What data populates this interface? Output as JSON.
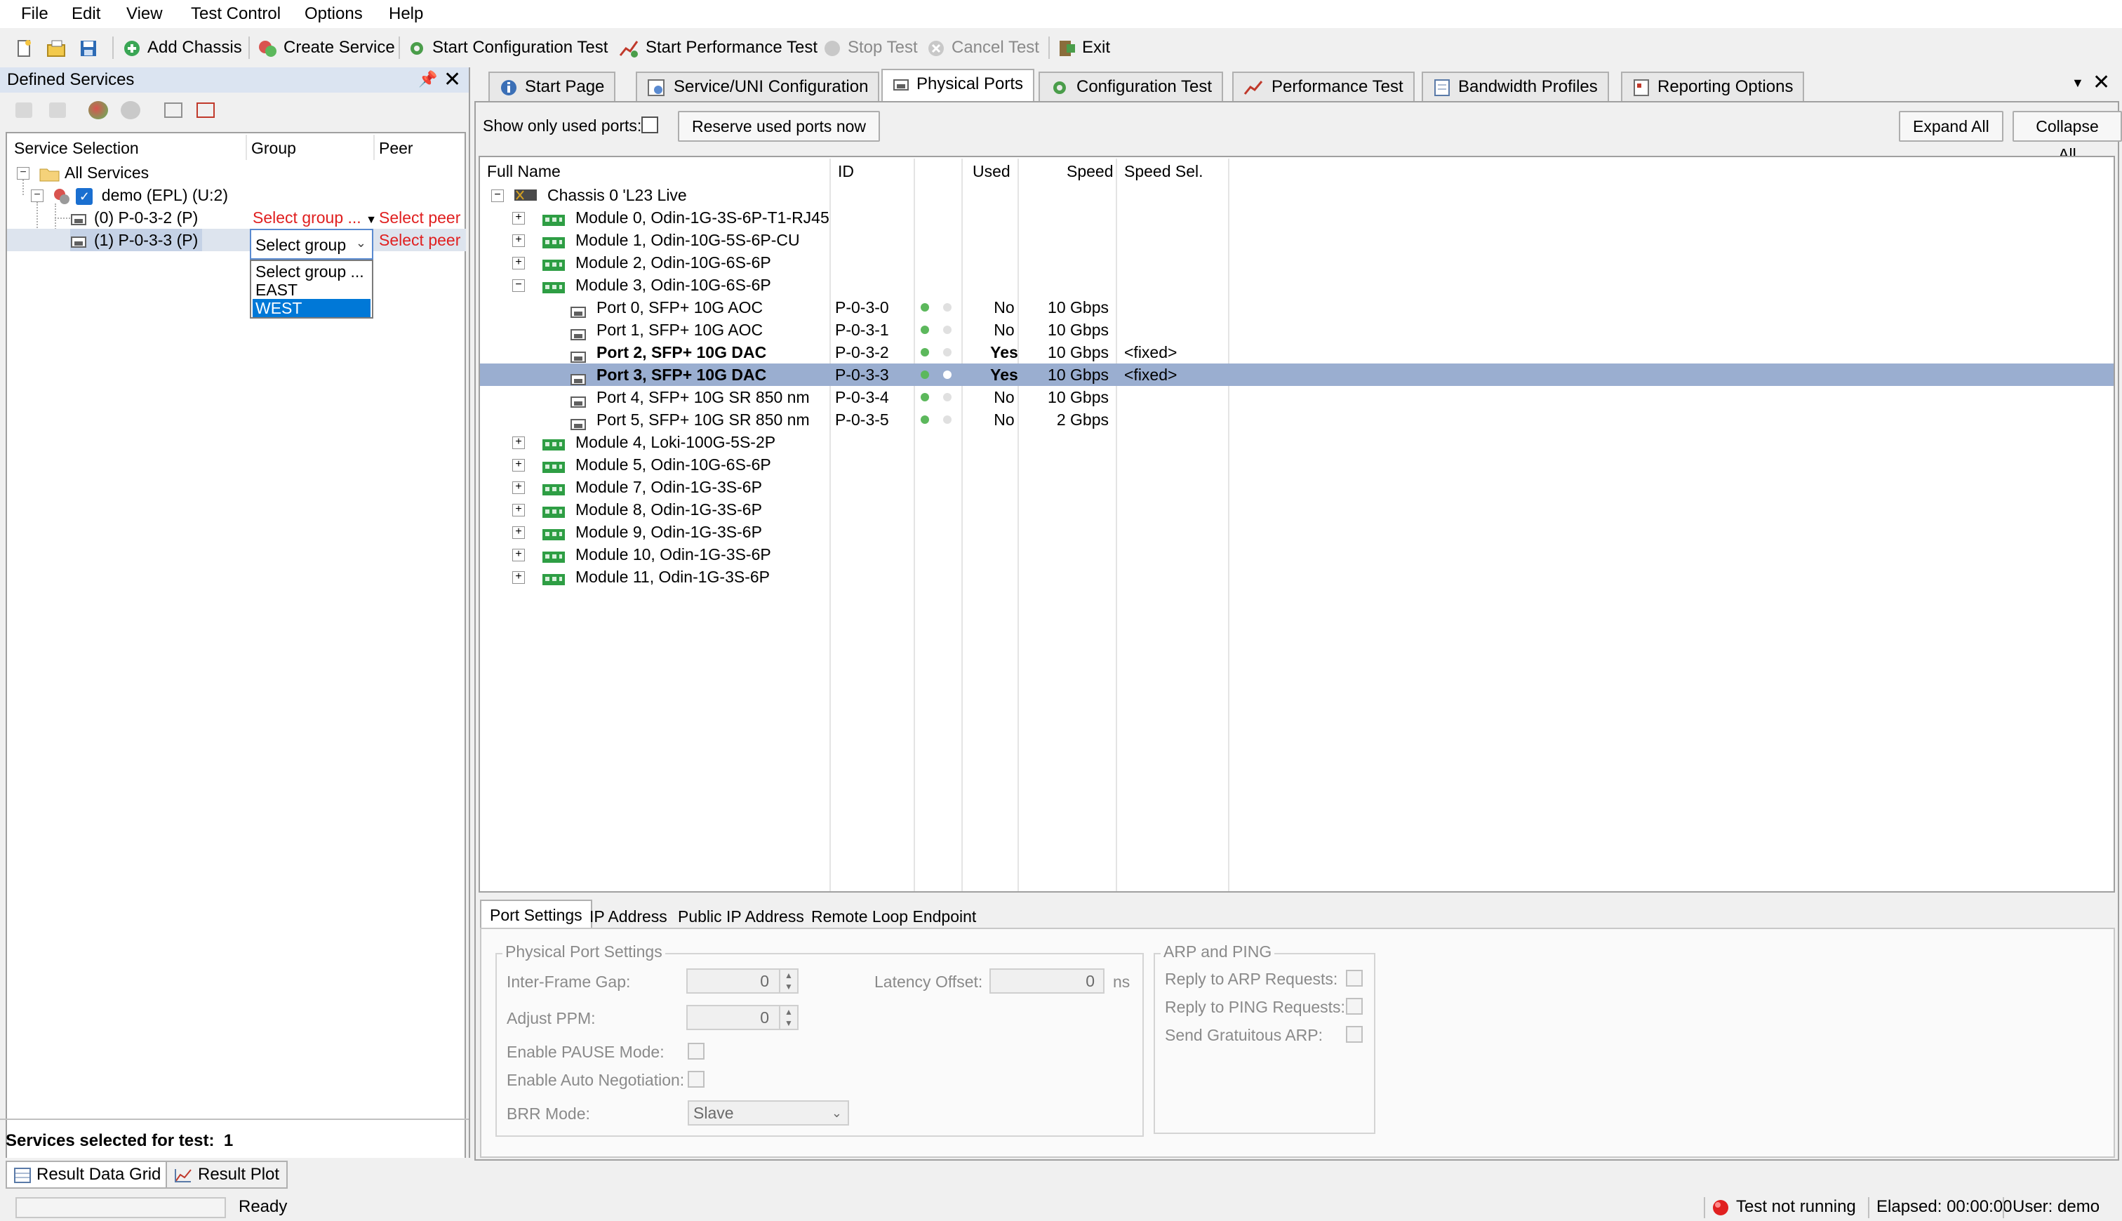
{
  "menu": [
    "File",
    "Edit",
    "View",
    "Test Control",
    "Options",
    "Help"
  ],
  "toolbar": {
    "add_chassis": "Add Chassis",
    "create_service": "Create Service",
    "start_config_test": "Start Configuration Test",
    "start_perf_test": "Start Performance Test",
    "stop_test": "Stop Test",
    "cancel_test": "Cancel Test",
    "exit": "Exit"
  },
  "left_panel": {
    "title": "Defined Services",
    "columns": {
      "selection": "Service Selection",
      "group": "Group",
      "peer": "Peer"
    },
    "tree": {
      "root": "All Services",
      "service": "demo (EPL) (U:2)",
      "ports": [
        {
          "label": "(0) P-0-3-2 (P)",
          "group": "Select group ...",
          "peer": "Select peer ..."
        },
        {
          "label": "(1) P-0-3-3 (P)",
          "group": "Select group",
          "peer": "Select peer ..."
        }
      ]
    },
    "dropdown_options": [
      "Select group ...",
      "EAST",
      "WEST"
    ],
    "services_selected_label": "Services selected for test:",
    "services_selected_count": "1",
    "bottom_tabs": [
      "Result Data Grid",
      "Result Plot"
    ]
  },
  "tabs": [
    "Start Page",
    "Service/UNI Configuration",
    "Physical Ports",
    "Configuration Test",
    "Performance Test",
    "Bandwidth Profiles",
    "Reporting Options"
  ],
  "ports_view": {
    "show_used_label": "Show only used ports:",
    "reserve_button": "Reserve used ports now",
    "expand_all": "Expand All",
    "collapse_all": "Collapse All",
    "columns": {
      "full_name": "Full Name",
      "id": "ID",
      "used": "Used",
      "speed": "Speed",
      "speed_sel": "Speed Sel."
    },
    "chassis": "Chassis 0 'L23 Live",
    "modules_before": [
      "Module 0, Odin-1G-3S-6P-T1-RJ45",
      "Module 1, Odin-10G-5S-6P-CU",
      "Module 2, Odin-10G-6S-6P"
    ],
    "expanded_module": "Module 3, Odin-10G-6S-6P",
    "ports": [
      {
        "name": "Port 0, SFP+ 10G AOC",
        "id": "P-0-3-0",
        "used": "No",
        "speed": "10 Gbps",
        "speed_sel": ""
      },
      {
        "name": "Port 1, SFP+ 10G AOC",
        "id": "P-0-3-1",
        "used": "No",
        "speed": "10 Gbps",
        "speed_sel": ""
      },
      {
        "name": "Port 2, SFP+ 10G DAC",
        "id": "P-0-3-2",
        "used": "Yes",
        "speed": "10 Gbps",
        "speed_sel": "<fixed>"
      },
      {
        "name": "Port 3, SFP+ 10G DAC",
        "id": "P-0-3-3",
        "used": "Yes",
        "speed": "10 Gbps",
        "speed_sel": "<fixed>"
      },
      {
        "name": "Port 4, SFP+ 10G SR 850 nm",
        "id": "P-0-3-4",
        "used": "No",
        "speed": "10 Gbps",
        "speed_sel": ""
      },
      {
        "name": "Port 5, SFP+ 10G SR 850 nm",
        "id": "P-0-3-5",
        "used": "No",
        "speed": "2 Gbps",
        "speed_sel": ""
      }
    ],
    "modules_after": [
      "Module 4, Loki-100G-5S-2P",
      "Module 5, Odin-10G-6S-6P",
      "Module 7, Odin-1G-3S-6P",
      "Module 8, Odin-1G-3S-6P",
      "Module 9, Odin-1G-3S-6P",
      "Module 10, Odin-1G-3S-6P",
      "Module 11, Odin-1G-3S-6P"
    ]
  },
  "bottom_tabs": [
    "Port Settings",
    "IP Address",
    "Public IP Address",
    "Remote Loop Endpoint"
  ],
  "port_settings": {
    "group_title": "Physical Port Settings",
    "ifg_label": "Inter-Frame Gap:",
    "ifg_value": "0",
    "ppm_label": "Adjust PPM:",
    "ppm_value": "0",
    "latency_label": "Latency Offset:",
    "latency_value": "0",
    "latency_unit": "ns",
    "pause_label": "Enable PAUSE Mode:",
    "autoneg_label": "Enable Auto Negotiation:",
    "brr_label": "BRR Mode:",
    "brr_value": "Slave"
  },
  "arp_ping": {
    "group_title": "ARP and PING",
    "reply_arp": "Reply to ARP Requests:",
    "reply_ping": "Reply to PING Requests:",
    "gratuitous": "Send Gratuitous ARP:"
  },
  "status": {
    "ready": "Ready",
    "test_state": "Test not running",
    "elapsed": "Elapsed: 00:00:00",
    "user": "User: demo"
  },
  "colors": {
    "selection": "#9aaed0",
    "accent_red": "#e02020",
    "led_green": "#5cb85c",
    "title_bg": "#dbe4f1"
  }
}
